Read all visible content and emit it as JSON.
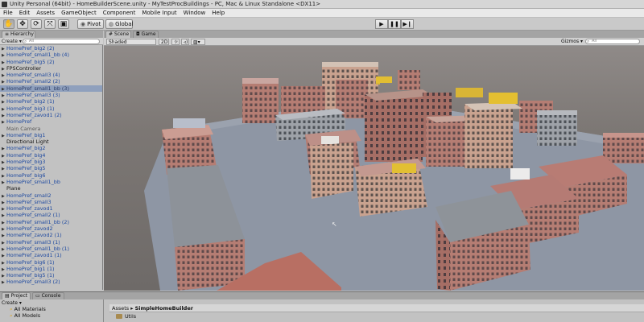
{
  "window": {
    "title": "Unity Personal (64bit) - HomeBuilderScene.unity - MyTestProcBuildings - PC, Mac & Linux Standalone <DX11>"
  },
  "menu": [
    "File",
    "Edit",
    "Assets",
    "GameObject",
    "Component",
    "Mobile Input",
    "Window",
    "Help"
  ],
  "toolbar": {
    "tools": [
      "hand-icon",
      "move-icon",
      "rotate-icon",
      "scale-icon",
      "rect-icon"
    ],
    "pivot_label": "Pivot",
    "global_label": "Global",
    "play_icons": [
      "play-icon",
      "pause-icon",
      "step-icon"
    ]
  },
  "hierarchy": {
    "tab_label": "Hierarchy",
    "create_label": "Create ▾",
    "search_placeholder": "All",
    "items": [
      {
        "label": "HomePref_big2 (2)",
        "state": "prefab",
        "arrow": true
      },
      {
        "label": "HomePref_small1_bb (4)",
        "state": "prefab",
        "arrow": true
      },
      {
        "label": "HomePref_big5 (2)",
        "state": "prefab",
        "arrow": true
      },
      {
        "label": "FPSController",
        "state": "plain",
        "arrow": true
      },
      {
        "label": "HomePref_small3 (4)",
        "state": "prefab",
        "arrow": true
      },
      {
        "label": "HomePref_small2 (2)",
        "state": "prefab",
        "arrow": true
      },
      {
        "label": "HomePref_small1_bb (3)",
        "state": "selected",
        "arrow": true
      },
      {
        "label": "HomePref_small3 (3)",
        "state": "prefab",
        "arrow": true
      },
      {
        "label": "HomePref_big2 (1)",
        "state": "prefab",
        "arrow": true
      },
      {
        "label": "HomePref_big3 (1)",
        "state": "prefab",
        "arrow": true
      },
      {
        "label": "HomePref_zavod1 (2)",
        "state": "prefab",
        "arrow": true
      },
      {
        "label": "HomePref",
        "state": "prefab",
        "arrow": true
      },
      {
        "label": "Main Camera",
        "state": "gray",
        "arrow": false
      },
      {
        "label": "HomePref_big1",
        "state": "prefab",
        "arrow": true
      },
      {
        "label": "Directional Light",
        "state": "plain",
        "arrow": false
      },
      {
        "label": "HomePref_big2",
        "state": "prefab",
        "arrow": true
      },
      {
        "label": "HomePref_big4",
        "state": "prefab",
        "arrow": true
      },
      {
        "label": "HomePref_big3",
        "state": "prefab",
        "arrow": true
      },
      {
        "label": "HomePref_big5",
        "state": "prefab",
        "arrow": true
      },
      {
        "label": "HomePref_big6",
        "state": "prefab",
        "arrow": true
      },
      {
        "label": "HomePref_small1_bb",
        "state": "prefab",
        "arrow": true
      },
      {
        "label": "Plane",
        "state": "plain",
        "arrow": false
      },
      {
        "label": "HomePref_small2",
        "state": "prefab",
        "arrow": true
      },
      {
        "label": "HomePref_small3",
        "state": "prefab",
        "arrow": true
      },
      {
        "label": "HomePref_zavod1",
        "state": "prefab",
        "arrow": true
      },
      {
        "label": "HomePref_small2 (1)",
        "state": "prefab",
        "arrow": true
      },
      {
        "label": "HomePref_small1_bb (2)",
        "state": "prefab",
        "arrow": true
      },
      {
        "label": "HomePref_zavod2",
        "state": "prefab",
        "arrow": true
      },
      {
        "label": "HomePref_zavod2 (1)",
        "state": "prefab",
        "arrow": true
      },
      {
        "label": "HomePref_small3 (1)",
        "state": "prefab",
        "arrow": true
      },
      {
        "label": "HomePref_small1_bb (1)",
        "state": "prefab",
        "arrow": true
      },
      {
        "label": "HomePref_zavod1 (1)",
        "state": "prefab",
        "arrow": true
      },
      {
        "label": "HomePref_big6 (1)",
        "state": "prefab",
        "arrow": true
      },
      {
        "label": "HomePref_big1 (1)",
        "state": "prefab",
        "arrow": true
      },
      {
        "label": "HomePref_big5 (1)",
        "state": "prefab",
        "arrow": true
      },
      {
        "label": "HomePref_small3 (2)",
        "state": "prefab",
        "arrow": true
      }
    ]
  },
  "scene": {
    "tab_scene": "Scene",
    "tab_game": "Game",
    "shading": "Shaded",
    "mode_2d": "2D",
    "gizmos": "Gizmos ▾",
    "search_placeholder": "All"
  },
  "project": {
    "tab_project": "Project",
    "tab_console": "Console",
    "create_label": "Create ▾",
    "favorites": [
      "All Materials",
      "All Models"
    ],
    "breadcrumb_root": "Assets",
    "breadcrumb_sep": "▸",
    "breadcrumb_current": "SimpleHomeBuilder",
    "folders": [
      "Utils"
    ]
  },
  "colors": {
    "prefab_text": "#1f4aa0",
    "selected_row": "#8fa0bd",
    "panel_bg": "#c2c2c2",
    "ground": "#8e96a4",
    "brick": "#b9837a"
  }
}
